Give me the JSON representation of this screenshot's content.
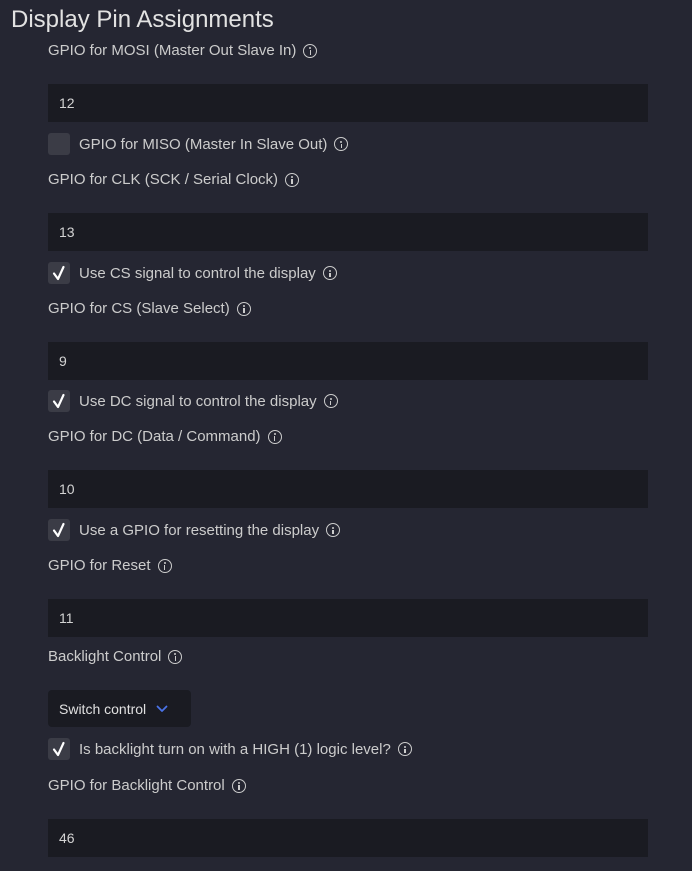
{
  "section": {
    "title": "Display Pin Assignments"
  },
  "mosi": {
    "label": "GPIO for MOSI (Master Out Slave In)",
    "value": "12"
  },
  "miso": {
    "label": "GPIO for MISO (Master In Slave Out)",
    "checked": false
  },
  "clk": {
    "label": "GPIO for CLK (SCK / Serial Clock)",
    "value": "13"
  },
  "use_cs": {
    "label": "Use CS signal to control the display",
    "checked": true
  },
  "cs": {
    "label": "GPIO for CS (Slave Select)",
    "value": "9"
  },
  "use_dc": {
    "label": "Use DC signal to control the display",
    "checked": true
  },
  "dc": {
    "label": "GPIO for DC (Data / Command)",
    "value": "10"
  },
  "use_reset": {
    "label": "Use a GPIO for resetting the display",
    "checked": true
  },
  "reset": {
    "label": "GPIO for Reset",
    "value": "11"
  },
  "backlight": {
    "label": "Backlight Control",
    "selected": "Switch control"
  },
  "backlight_high": {
    "label": "Is backlight turn on with a HIGH (1) logic level?",
    "checked": true
  },
  "backlight_gpio": {
    "label": "GPIO for Backlight Control",
    "value": "46"
  },
  "colors": {
    "background": "#252632",
    "field": "#1a1b22",
    "checkbox": "#3b3c46",
    "chevron": "#4a73e8"
  },
  "icons": {
    "info": "info-icon",
    "check": "checkmark-icon",
    "dropdown": "chevron-down-icon"
  }
}
